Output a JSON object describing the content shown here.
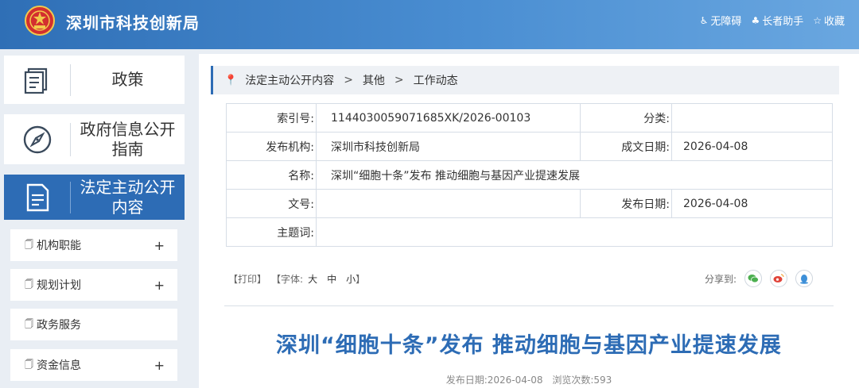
{
  "header": {
    "site_title": "深圳市科技创新局",
    "links": [
      {
        "icon": "accessibility-icon",
        "label": "无障碍"
      },
      {
        "icon": "elder-assist-icon",
        "label": "长者助手"
      },
      {
        "icon": "star-icon",
        "label": "收藏"
      }
    ]
  },
  "sidebar": {
    "cards": [
      {
        "icon": "policy-book-icon",
        "label": "政策"
      },
      {
        "icon": "compass-icon",
        "label": "政府信息公开指南"
      },
      {
        "icon": "document-icon",
        "label": "法定主动公开内容",
        "active": true
      }
    ],
    "sub_items": [
      {
        "label": "机构职能",
        "expand": "+"
      },
      {
        "label": "规划计划",
        "expand": "+"
      },
      {
        "label": "政务服务",
        "expand": ""
      },
      {
        "label": "资金信息",
        "expand": "+"
      }
    ]
  },
  "breadcrumb": {
    "items": [
      "法定主动公开内容",
      "其他",
      "工作动态"
    ],
    "separator": ">"
  },
  "meta_table": {
    "index_no_label": "索引号:",
    "index_no_value": "1144030059071685XK/2026-00103",
    "category_label": "分类:",
    "category_value": "",
    "publisher_label": "发布机构:",
    "publisher_value": "深圳市科技创新局",
    "written_date_label": "成文日期:",
    "written_date_value": "2026-04-08",
    "name_label": "名称:",
    "name_value": "深圳“细胞十条”发布 推动细胞与基因产业提速发展",
    "doc_no_label": "文号:",
    "doc_no_value": "",
    "publish_date_label": "发布日期:",
    "publish_date_value": "2026-04-08",
    "subject_label": "主题词:",
    "subject_value": ""
  },
  "toolbar": {
    "print": "【打印】",
    "font_prefix": "【字体:",
    "font_large": "大",
    "font_medium": "中",
    "font_small": "小",
    "font_suffix": "】",
    "share_label": "分享到:"
  },
  "article": {
    "title": "深圳“细胞十条”发布 推动细胞与基因产业提速发展",
    "publish_date": "发布日期:2026-04-08",
    "views": "浏览次数:593"
  },
  "colors": {
    "brand_blue": "#2d6cb5",
    "header_gradient_start": "#2f6fb6",
    "header_gradient_end": "#6aa7e0",
    "wechat_green": "#4caf50",
    "weibo_red": "#e0443a",
    "qq_blue": "#3d8fd8"
  }
}
